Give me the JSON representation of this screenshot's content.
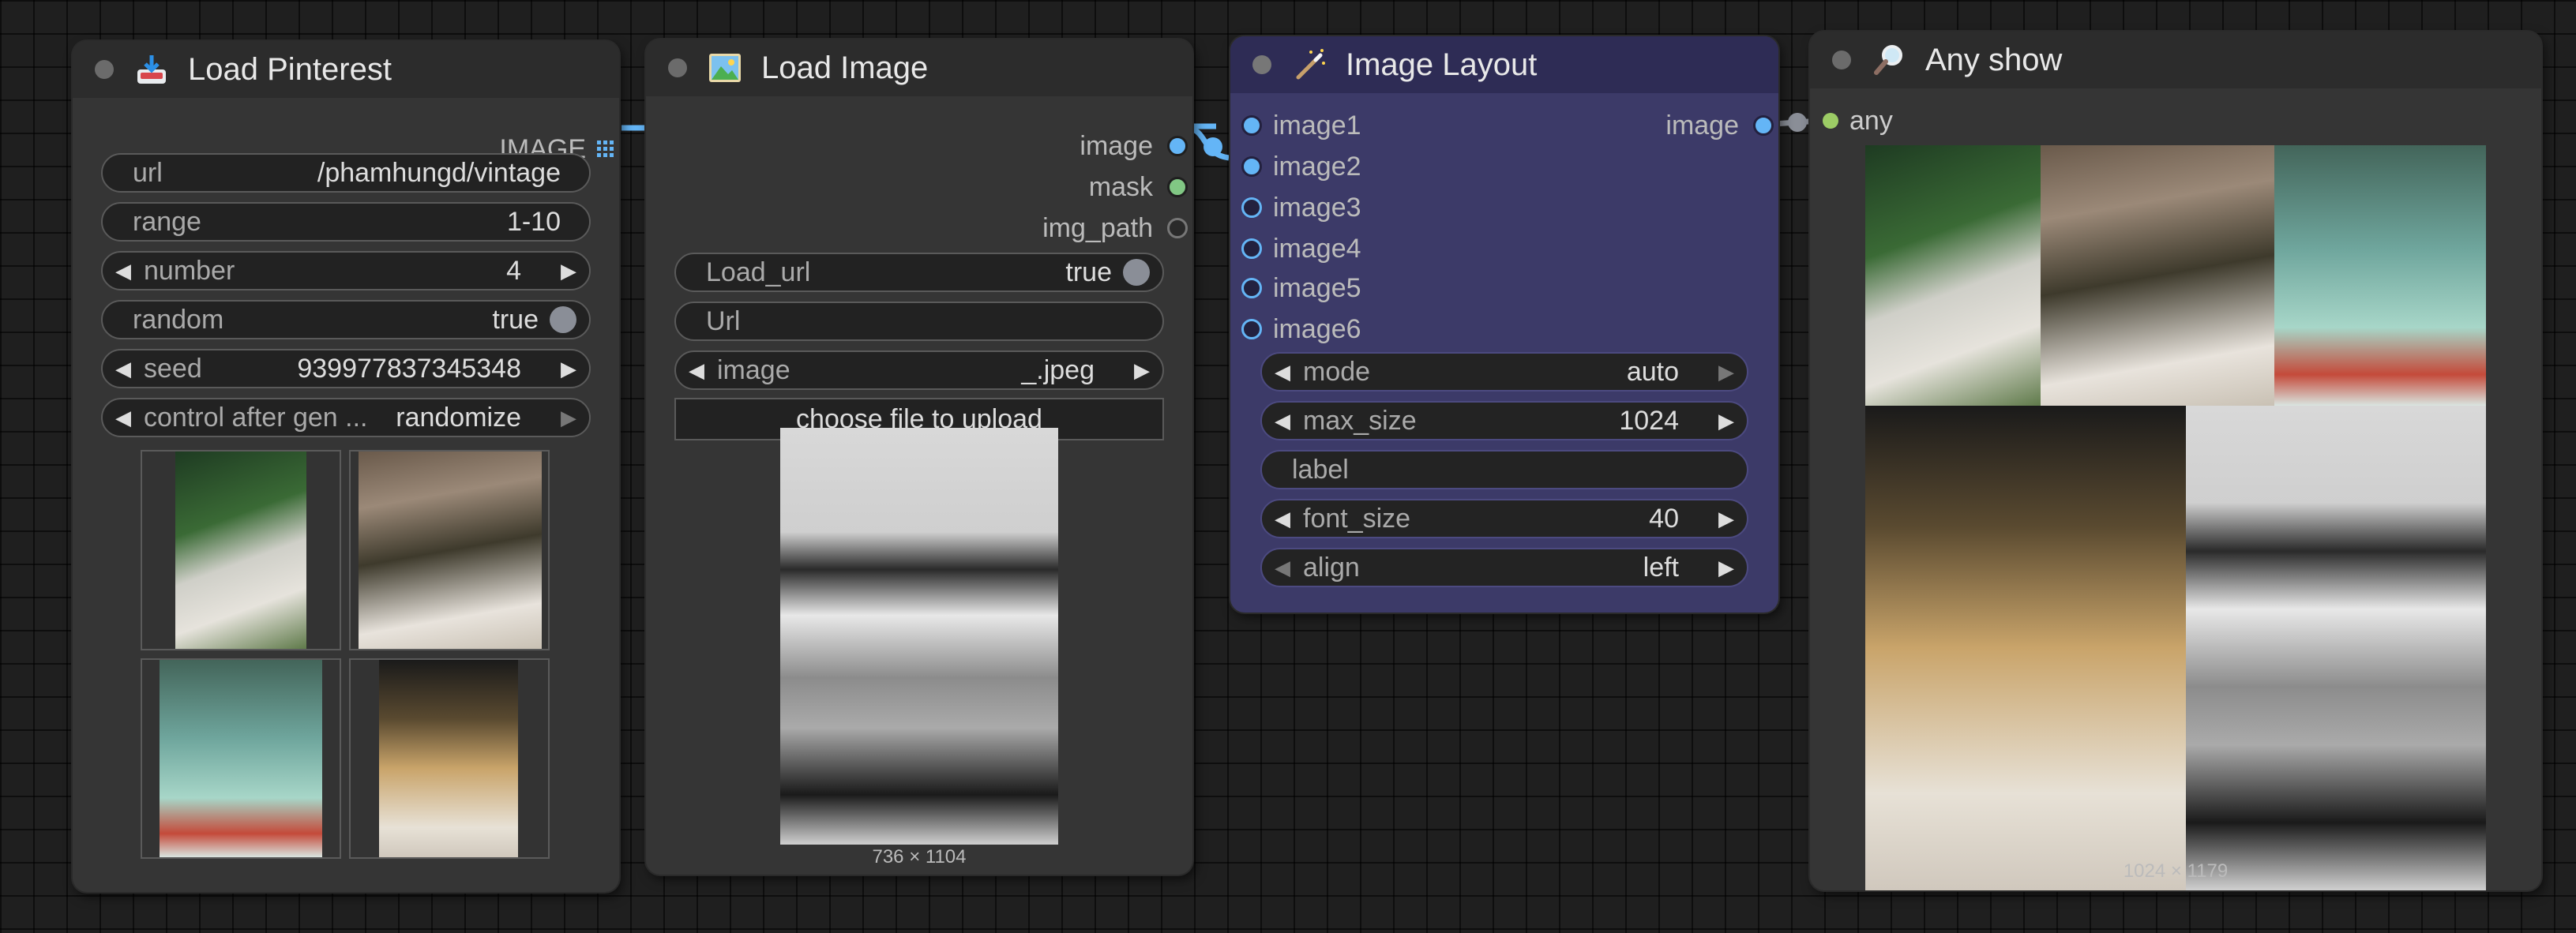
{
  "nodes": {
    "load_pinterest": {
      "title": "Load Pinterest",
      "output_label": "IMAGE",
      "widgets": {
        "url_label": "url",
        "url_value": "/phamhungd/vintage",
        "range_label": "range",
        "range_value": "1-10",
        "number_label": "number",
        "number_value": "4",
        "random_label": "random",
        "random_value": "true",
        "seed_label": "seed",
        "seed_value": "939977837345348",
        "control_label": "control after gen ...",
        "control_value": "randomize"
      }
    },
    "load_image": {
      "title": "Load Image",
      "outputs": [
        "image",
        "mask",
        "img_path"
      ],
      "widgets": {
        "load_url_label": "Load_url",
        "load_url_value": "true",
        "url_label": "Url",
        "image_label": "image",
        "image_value": "_.jpeg",
        "upload_label": "choose file to upload"
      },
      "preview_size": "736 × 1104"
    },
    "image_layout": {
      "title": "Image Layout",
      "inputs": [
        "image1",
        "image2",
        "image3",
        "image4",
        "image5",
        "image6"
      ],
      "output_label": "image",
      "widgets": {
        "mode_label": "mode",
        "mode_value": "auto",
        "max_size_label": "max_size",
        "max_size_value": "1024",
        "label_label": "label",
        "font_size_label": "font_size",
        "font_size_value": "40",
        "align_label": "align",
        "align_value": "left"
      }
    },
    "any_show": {
      "title": "Any show",
      "input_label": "any",
      "preview_size": "1024 × 1179"
    }
  },
  "colors": {
    "canvas": "#1f1f1f",
    "node_body": "#353535",
    "node_title": "#2c2c2c",
    "layout_body": "#3c3a68",
    "image_socket": "#64b5f6",
    "mask_socket": "#81c784",
    "any_socket": "#9ccc65",
    "link": "#64b5f6"
  },
  "icons": [
    "inbox-download-icon",
    "landscape-picture-icon",
    "magic-wand-icon",
    "magnifier-icon",
    "grid-icon"
  ]
}
